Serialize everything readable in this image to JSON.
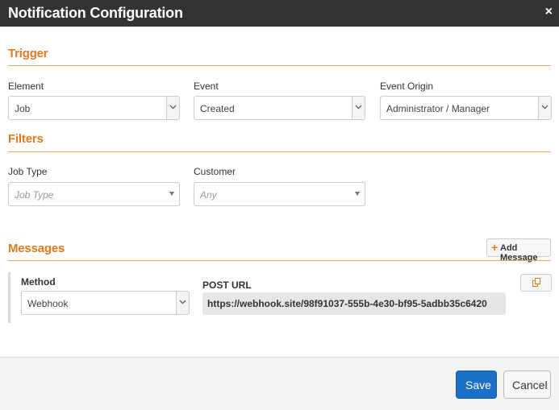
{
  "dialog": {
    "title": "Notification Configuration",
    "close_label": "×"
  },
  "trigger": {
    "heading": "Trigger",
    "element": {
      "label": "Element",
      "value": "Job"
    },
    "event": {
      "label": "Event",
      "value": "Created"
    },
    "event_origin": {
      "label": "Event Origin",
      "value": "Administrator / Manager"
    }
  },
  "filters": {
    "heading": "Filters",
    "job_type": {
      "label": "Job Type",
      "placeholder": "Job Type"
    },
    "customer": {
      "label": "Customer",
      "placeholder": "Any"
    }
  },
  "messages": {
    "heading": "Messages",
    "add_button_plus": "+",
    "add_button_label": "Add Message",
    "method": {
      "label": "Method",
      "value": "Webhook"
    },
    "post_url": {
      "label": "POST URL",
      "value": "https://webhook.site/98f91037-555b-4e30-bf95-5adbb35c6420"
    }
  },
  "footer": {
    "save_label": "Save",
    "cancel_label": "Cancel"
  },
  "colors": {
    "accent": "#e07a1f",
    "title_bar": "#333333",
    "primary_button": "#1c6fc7"
  },
  "icons": [
    "close-icon",
    "chevron-down-icon",
    "caret-down-icon",
    "plus-icon",
    "copy-icon"
  ]
}
